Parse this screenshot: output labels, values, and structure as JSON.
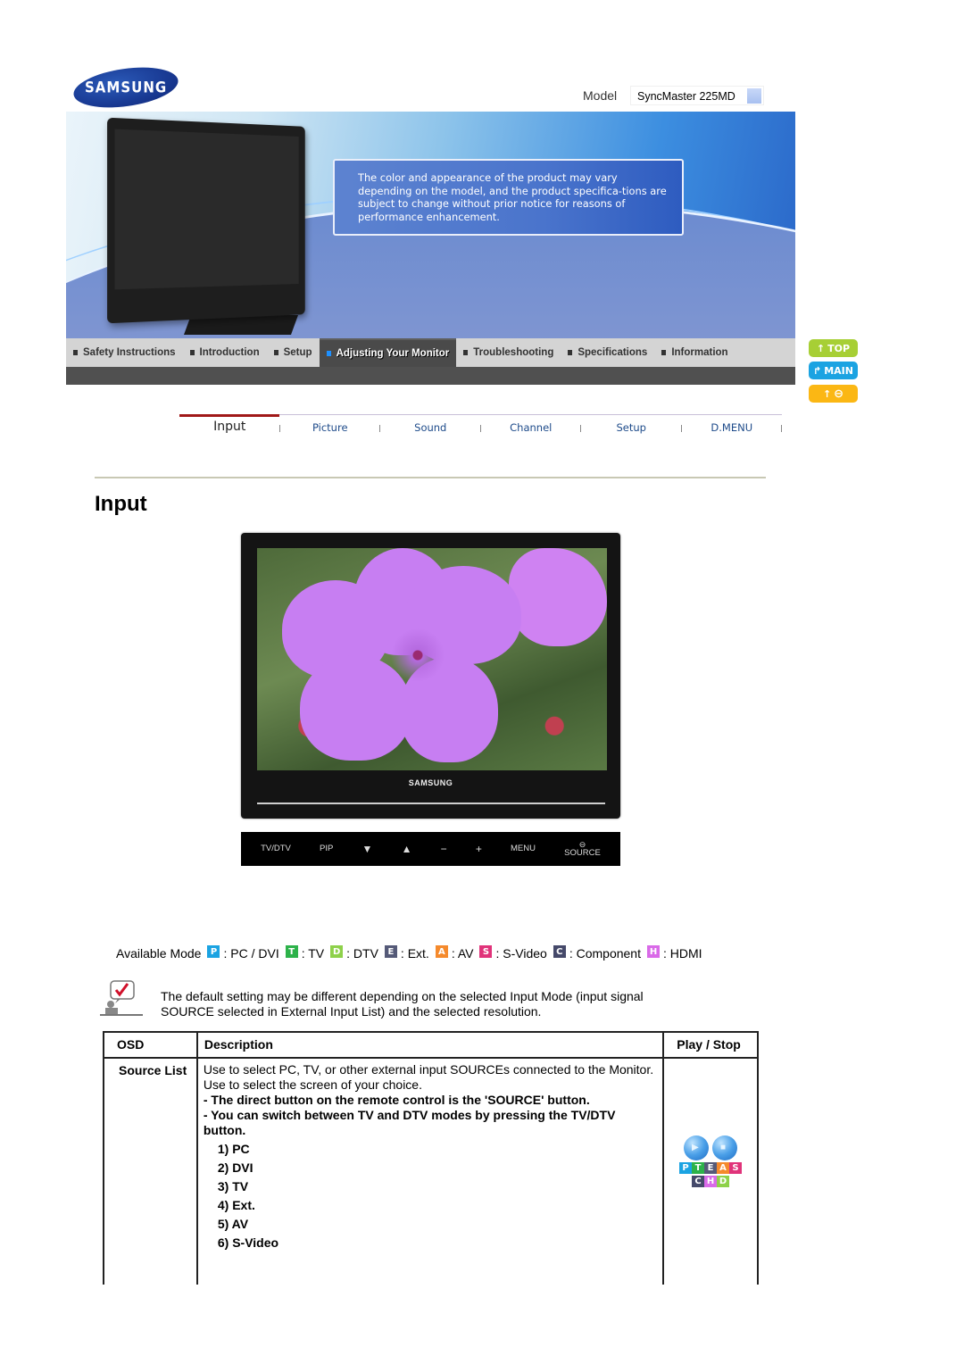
{
  "header": {
    "brand": "SAMSUNG",
    "model_label": "Model",
    "model_value": "SyncMaster 225MD",
    "notice": "The color and appearance of the product may vary depending on the model, and the product specifica-tions are subject to change without prior notice for reasons of performance enhancement."
  },
  "nav": {
    "items": [
      {
        "label": "Safety Instructions",
        "active": false
      },
      {
        "label": "Introduction",
        "active": false
      },
      {
        "label": "Setup",
        "active": false
      },
      {
        "label": "Adjusting Your Monitor",
        "active": true
      },
      {
        "label": "Troubleshooting",
        "active": false
      },
      {
        "label": "Specifications",
        "active": false
      },
      {
        "label": "Information",
        "active": false
      }
    ],
    "side_buttons": [
      {
        "label": "TOP",
        "icon": "arrow-up-icon",
        "color": "#a7cf35"
      },
      {
        "label": "MAIN",
        "icon": "arrow-turn-up-icon",
        "color": "#1ba3e2"
      },
      {
        "label": "",
        "icon": "arrow-up-back-icon",
        "color": "#fbb714"
      }
    ]
  },
  "subtabs": {
    "items": [
      "Input",
      "Picture",
      "Sound",
      "Channel",
      "Setup",
      "D.MENU"
    ],
    "active_index": 0,
    "accent_color": "#a01818"
  },
  "page": {
    "title": "Input"
  },
  "monitor_photo": {
    "brand": "SAMSUNG"
  },
  "control_bar": {
    "buttons": [
      "TV/DTV",
      "PIP",
      "▼",
      "▲",
      "−",
      "+",
      "MENU",
      "SOURCE"
    ]
  },
  "available_mode": {
    "label": "Available Mode",
    "modes": [
      {
        "letter": "P",
        "text": ": PC / DVI",
        "color": "#1ba3e2"
      },
      {
        "letter": "T",
        "text": ": TV",
        "color": "#2db24a"
      },
      {
        "letter": "D",
        "text": ": DTV",
        "color": "#8ed14a"
      },
      {
        "letter": "E",
        "text": ": Ext.",
        "color": "#555a78"
      },
      {
        "letter": "A",
        "text": ": AV",
        "color": "#f58a2c"
      },
      {
        "letter": "S",
        "text": ": S-Video",
        "color": "#e0337a"
      },
      {
        "letter": "C",
        "text": ": Component",
        "color": "#45496a"
      },
      {
        "letter": "H",
        "text": ": HDMI",
        "color": "#d96ae8"
      }
    ]
  },
  "note": {
    "text": "The default setting may be different depending on the selected Input Mode (input signal SOURCE selected in External Input List) and the selected resolution."
  },
  "table": {
    "headers": [
      "OSD",
      "Description",
      "Play / Stop"
    ],
    "rows": [
      {
        "osd": "Source List",
        "lines": [
          "Use to select PC, TV, or other external input SOURCEs connected to the Monitor.",
          "Use to select the screen of your choice."
        ],
        "bold_lines": [
          "- The direct button on the remote control is the 'SOURCE' button.",
          "- You can switch between TV and DTV modes by pressing the TV/DTV button."
        ],
        "list": [
          "1) PC",
          "2) DVI",
          "3) TV",
          "4) Ext.",
          "5) AV",
          "6) S-Video"
        ],
        "play_stop": {
          "buttons": [
            "play",
            "stop"
          ],
          "mode_letters_row1": [
            {
              "letter": "P",
              "color": "#1ba3e2"
            },
            {
              "letter": "T",
              "color": "#2db24a"
            },
            {
              "letter": "E",
              "color": "#555a78"
            },
            {
              "letter": "A",
              "color": "#f58a2c"
            },
            {
              "letter": "S",
              "color": "#e0337a"
            }
          ],
          "mode_letters_row2": [
            {
              "letter": "C",
              "color": "#45496a"
            },
            {
              "letter": "H",
              "color": "#d96ae8"
            },
            {
              "letter": "D",
              "color": "#8ed14a"
            }
          ]
        }
      }
    ]
  }
}
